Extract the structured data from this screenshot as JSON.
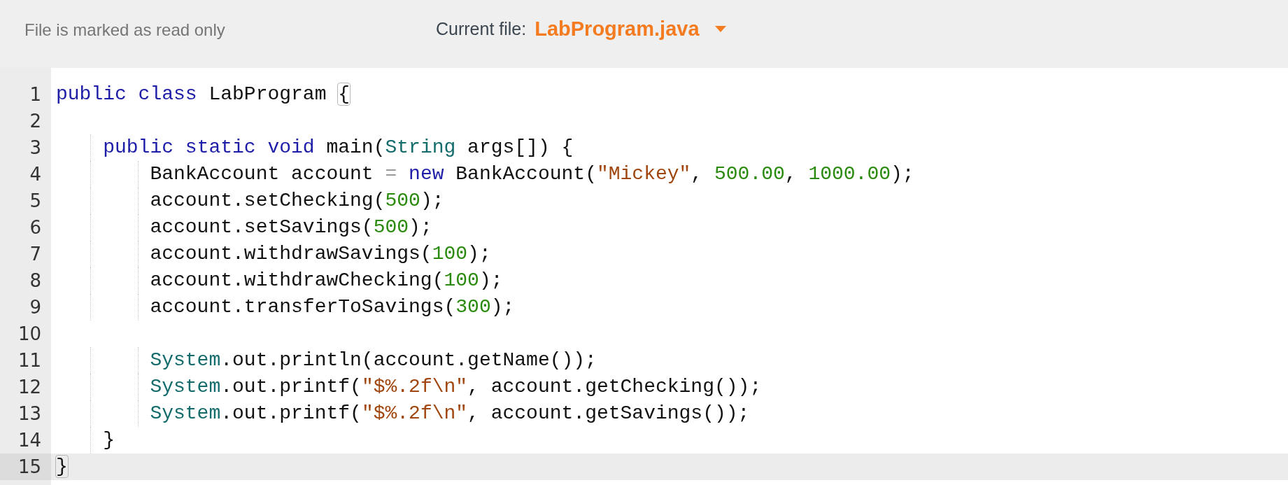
{
  "header": {
    "status": "File is marked as read only",
    "file_label": "Current file:",
    "file_name": "LabProgram.java"
  },
  "editor": {
    "lines": [
      {
        "number": "1",
        "active": false,
        "tokens": [
          {
            "kind": "keyword",
            "text": "public class"
          },
          {
            "kind": "plain",
            "text": " LabProgram "
          },
          {
            "kind": "bracket",
            "text": "{",
            "matched": true
          }
        ]
      },
      {
        "number": "2",
        "active": false
      },
      {
        "number": "3",
        "active": false,
        "tokens": [
          {
            "kind": "keyword",
            "text": "    public static void"
          },
          {
            "kind": "plain",
            "text": " main("
          },
          {
            "kind": "type",
            "text": "String"
          },
          {
            "kind": "plain",
            "text": " args[]) {"
          }
        ]
      },
      {
        "number": "4",
        "active": false,
        "tokens": [
          {
            "kind": "plain",
            "text": "        BankAccount account "
          },
          {
            "kind": "operator",
            "text": "= "
          },
          {
            "kind": "keyword",
            "text": "new"
          },
          {
            "kind": "plain",
            "text": " BankAccount("
          },
          {
            "kind": "string",
            "text": "\"Mickey\""
          },
          {
            "kind": "plain",
            "text": ", "
          },
          {
            "kind": "number",
            "text": "500.00"
          },
          {
            "kind": "plain",
            "text": ", "
          },
          {
            "kind": "number",
            "text": "1000.00"
          },
          {
            "kind": "plain",
            "text": ");"
          }
        ]
      },
      {
        "number": "5",
        "active": false,
        "tokens": [
          {
            "kind": "plain",
            "text": "        account.setChecking("
          },
          {
            "kind": "number",
            "text": "500"
          },
          {
            "kind": "plain",
            "text": ");"
          }
        ]
      },
      {
        "number": "6",
        "active": false,
        "tokens": [
          {
            "kind": "plain",
            "text": "        account.setSavings("
          },
          {
            "kind": "number",
            "text": "500"
          },
          {
            "kind": "plain",
            "text": ");"
          }
        ]
      },
      {
        "number": "7",
        "active": false,
        "tokens": [
          {
            "kind": "plain",
            "text": "        account.withdrawSavings("
          },
          {
            "kind": "number",
            "text": "100"
          },
          {
            "kind": "plain",
            "text": ");"
          }
        ]
      },
      {
        "number": "8",
        "active": false,
        "tokens": [
          {
            "kind": "plain",
            "text": "        account.withdrawChecking("
          },
          {
            "kind": "number",
            "text": "100"
          },
          {
            "kind": "plain",
            "text": ");"
          }
        ]
      },
      {
        "number": "9",
        "active": false,
        "tokens": [
          {
            "kind": "plain",
            "text": "        account.transferToSavings("
          },
          {
            "kind": "number",
            "text": "300"
          },
          {
            "kind": "plain",
            "text": ");"
          }
        ]
      },
      {
        "number": "10",
        "active": false
      },
      {
        "number": "11",
        "active": false,
        "tokens": [
          {
            "kind": "type",
            "text": "        System"
          },
          {
            "kind": "plain",
            "text": ".out.println(account.getName());"
          }
        ]
      },
      {
        "number": "12",
        "active": false,
        "tokens": [
          {
            "kind": "type",
            "text": "        System"
          },
          {
            "kind": "plain",
            "text": ".out.printf("
          },
          {
            "kind": "string",
            "text": "\"$%.2f\\n\""
          },
          {
            "kind": "plain",
            "text": ", account.getChecking());"
          }
        ]
      },
      {
        "number": "13",
        "active": false,
        "tokens": [
          {
            "kind": "type",
            "text": "        System"
          },
          {
            "kind": "plain",
            "text": ".out.printf("
          },
          {
            "kind": "string",
            "text": "\"$%.2f\\n\""
          },
          {
            "kind": "plain",
            "text": ", account.getSavings());"
          }
        ]
      },
      {
        "number": "14",
        "active": false,
        "tokens": [
          {
            "kind": "plain",
            "text": "    }"
          }
        ]
      },
      {
        "number": "15",
        "active": true,
        "tokens": [
          {
            "kind": "bracket",
            "text": "}",
            "matched": true
          }
        ]
      }
    ]
  }
}
